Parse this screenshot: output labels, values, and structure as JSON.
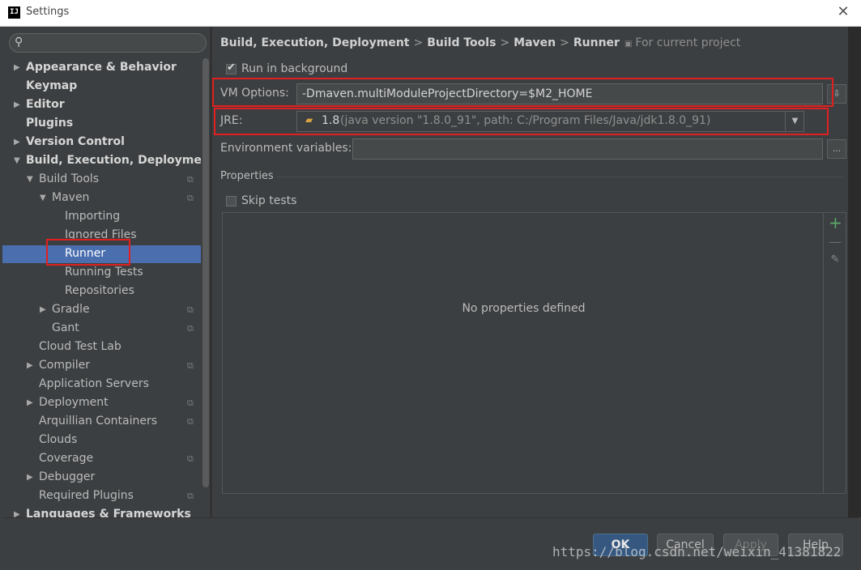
{
  "window": {
    "title": "Settings",
    "app_icon": "IJ"
  },
  "search": {
    "placeholder": ""
  },
  "tree": [
    {
      "label": "Appearance & Behavior",
      "bold": true,
      "arrow": "right",
      "indent": 0,
      "copy": false
    },
    {
      "label": "Keymap",
      "bold": true,
      "arrow": "",
      "indent": 0,
      "copy": false
    },
    {
      "label": "Editor",
      "bold": true,
      "arrow": "right",
      "indent": 0,
      "copy": false
    },
    {
      "label": "Plugins",
      "bold": true,
      "arrow": "",
      "indent": 0,
      "copy": false
    },
    {
      "label": "Version Control",
      "bold": true,
      "arrow": "right",
      "indent": 0,
      "copy": false
    },
    {
      "label": "Build, Execution, Deployment",
      "bold": true,
      "arrow": "down",
      "indent": 0,
      "copy": false
    },
    {
      "label": "Build Tools",
      "bold": false,
      "arrow": "down",
      "indent": 1,
      "copy": true
    },
    {
      "label": "Maven",
      "bold": false,
      "arrow": "down",
      "indent": 2,
      "copy": true
    },
    {
      "label": "Importing",
      "bold": false,
      "arrow": "",
      "indent": 3,
      "copy": false
    },
    {
      "label": "Ignored Files",
      "bold": false,
      "arrow": "",
      "indent": 3,
      "copy": false
    },
    {
      "label": "Runner",
      "bold": false,
      "arrow": "",
      "indent": 3,
      "copy": false,
      "selected": true
    },
    {
      "label": "Running Tests",
      "bold": false,
      "arrow": "",
      "indent": 3,
      "copy": false
    },
    {
      "label": "Repositories",
      "bold": false,
      "arrow": "",
      "indent": 3,
      "copy": false
    },
    {
      "label": "Gradle",
      "bold": false,
      "arrow": "right",
      "indent": 2,
      "copy": true
    },
    {
      "label": "Gant",
      "bold": false,
      "arrow": "",
      "indent": 2,
      "copy": true
    },
    {
      "label": "Cloud Test Lab",
      "bold": false,
      "arrow": "",
      "indent": 1,
      "copy": false
    },
    {
      "label": "Compiler",
      "bold": false,
      "arrow": "right",
      "indent": 1,
      "copy": true
    },
    {
      "label": "Application Servers",
      "bold": false,
      "arrow": "",
      "indent": 1,
      "copy": false
    },
    {
      "label": "Deployment",
      "bold": false,
      "arrow": "right",
      "indent": 1,
      "copy": true
    },
    {
      "label": "Arquillian Containers",
      "bold": false,
      "arrow": "",
      "indent": 1,
      "copy": true
    },
    {
      "label": "Clouds",
      "bold": false,
      "arrow": "",
      "indent": 1,
      "copy": false
    },
    {
      "label": "Coverage",
      "bold": false,
      "arrow": "",
      "indent": 1,
      "copy": true
    },
    {
      "label": "Debugger",
      "bold": false,
      "arrow": "right",
      "indent": 1,
      "copy": false
    },
    {
      "label": "Required Plugins",
      "bold": false,
      "arrow": "",
      "indent": 1,
      "copy": true
    },
    {
      "label": "Languages & Frameworks",
      "bold": true,
      "arrow": "right",
      "indent": 0,
      "copy": false
    }
  ],
  "breadcrumb": {
    "items": [
      "Build, Execution, Deployment",
      "Build Tools",
      "Maven",
      "Runner"
    ],
    "separator": ">",
    "scope": "For current project"
  },
  "runner": {
    "run_in_background": {
      "label": "Run in background",
      "checked": true
    },
    "vm_options": {
      "label": "VM Options:",
      "value": "-Dmaven.multiModuleProjectDirectory=$M2_HOME"
    },
    "jre": {
      "label": "JRE:",
      "version": "1.8",
      "detail": "(java version \"1.8.0_91\", path: C:/Program Files/Java/jdk1.8.0_91)"
    },
    "env_vars": {
      "label": "Environment variables:",
      "value": "",
      "browse": "..."
    },
    "properties": {
      "title": "Properties",
      "empty_text": "No properties defined"
    },
    "skip_tests": {
      "label": "Skip tests",
      "checked": false
    }
  },
  "buttons": {
    "ok": "OK",
    "cancel": "Cancel",
    "apply": "Apply",
    "help": "Help"
  },
  "watermark": "https://blog.csdn.net/weixin_41381822",
  "colors": {
    "selection": "#4b6eaf",
    "highlight_box": "#e02020",
    "add": "#59a869"
  }
}
